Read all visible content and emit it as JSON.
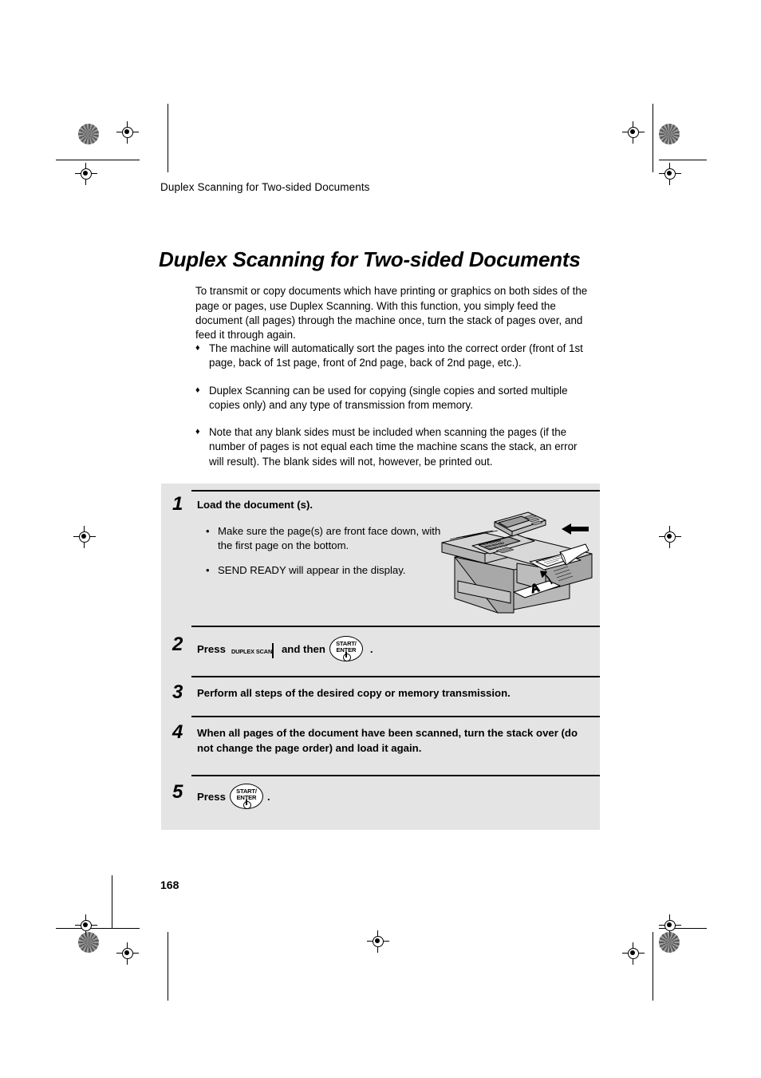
{
  "document": {
    "running_head": "Duplex Scanning for Two-sided Documents",
    "title": "Duplex Scanning for Two-sided Documents",
    "page_number": "168"
  },
  "intro": {
    "text": "To transmit or copy documents which have printing or graphics on both sides of the page or pages, use Duplex Scanning. With this function, you simply feed the document (all pages) through the machine once, turn the stack of pages over, and feed it through again."
  },
  "bullets": [
    {
      "marker": "♦",
      "text": "The machine will automatically sort the pages into the correct order (front of 1st page, back of 1st page, front of 2nd page, back of 2nd page, etc.)."
    },
    {
      "marker": "♦",
      "text": "Duplex Scanning can be used for copying (single copies and sorted multiple copies only) and any type of transmission from memory."
    },
    {
      "marker": "♦",
      "text": "Note that any blank sides must be included when scanning the pages (if the number of pages is not equal each time the machine scans the stack, an error will result). The blank sides will not, however, be printed out."
    }
  ],
  "steps": {
    "step1": {
      "number": "1",
      "heading": "Load the document (s).",
      "sub": [
        {
          "marker": "•",
          "text": "Make sure the page(s) are front face down, with the first page on the bottom."
        },
        {
          "marker": "•",
          "text": "SEND READY will appear in the display."
        }
      ]
    },
    "step2": {
      "number": "2",
      "press_label": "Press",
      "and_then_label": "and then",
      "period": ".",
      "duplex_key": "DUPLEX SCAN",
      "start_key_line1": "START/",
      "start_key_line2": "ENTER"
    },
    "step3": {
      "number": "3",
      "heading": "Perform all steps of the desired copy or memory transmission."
    },
    "step4": {
      "number": "4",
      "heading": "When all pages of the document have been scanned, turn the stack over (do not change the page order) and load it again."
    },
    "step5": {
      "number": "5",
      "press_label": "Press",
      "period": ".",
      "start_key_line1": "START/",
      "start_key_line2": "ENTER"
    }
  },
  "illustration": {
    "name": "fax-machine-loading-document",
    "document_sheet_letter": "A"
  },
  "colors": {
    "panel_background": "#e4e4e4",
    "text": "#000000",
    "page_background": "#ffffff"
  }
}
